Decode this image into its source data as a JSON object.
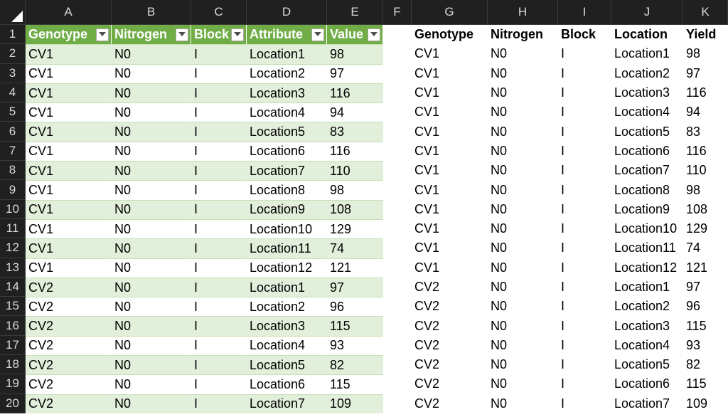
{
  "column_headers": [
    "A",
    "B",
    "C",
    "D",
    "E",
    "F",
    "G",
    "H",
    "I",
    "J",
    "K"
  ],
  "table": {
    "headers": [
      "Genotype",
      "Nitrogen",
      "Block",
      "Attribute",
      "Value"
    ],
    "rows": [
      [
        "CV1",
        "N0",
        "I",
        "Location1",
        "98"
      ],
      [
        "CV1",
        "N0",
        "I",
        "Location2",
        "97"
      ],
      [
        "CV1",
        "N0",
        "I",
        "Location3",
        "116"
      ],
      [
        "CV1",
        "N0",
        "I",
        "Location4",
        "94"
      ],
      [
        "CV1",
        "N0",
        "I",
        "Location5",
        "83"
      ],
      [
        "CV1",
        "N0",
        "I",
        "Location6",
        "116"
      ],
      [
        "CV1",
        "N0",
        "I",
        "Location7",
        "110"
      ],
      [
        "CV1",
        "N0",
        "I",
        "Location8",
        "98"
      ],
      [
        "CV1",
        "N0",
        "I",
        "Location9",
        "108"
      ],
      [
        "CV1",
        "N0",
        "I",
        "Location10",
        "129"
      ],
      [
        "CV1",
        "N0",
        "I",
        "Location11",
        "74"
      ],
      [
        "CV1",
        "N0",
        "I",
        "Location12",
        "121"
      ],
      [
        "CV2",
        "N0",
        "I",
        "Location1",
        "97"
      ],
      [
        "CV2",
        "N0",
        "I",
        "Location2",
        "96"
      ],
      [
        "CV2",
        "N0",
        "I",
        "Location3",
        "115"
      ],
      [
        "CV2",
        "N0",
        "I",
        "Location4",
        "93"
      ],
      [
        "CV2",
        "N0",
        "I",
        "Location5",
        "82"
      ],
      [
        "CV2",
        "N0",
        "I",
        "Location6",
        "115"
      ],
      [
        "CV2",
        "N0",
        "I",
        "Location7",
        "109"
      ]
    ]
  },
  "output": {
    "headers": [
      "Genotype",
      "Nitrogen",
      "Block",
      "Location",
      "Yield"
    ],
    "rows": [
      [
        "CV1",
        "N0",
        "I",
        "Location1",
        "98"
      ],
      [
        "CV1",
        "N0",
        "I",
        "Location2",
        "97"
      ],
      [
        "CV1",
        "N0",
        "I",
        "Location3",
        "116"
      ],
      [
        "CV1",
        "N0",
        "I",
        "Location4",
        "94"
      ],
      [
        "CV1",
        "N0",
        "I",
        "Location5",
        "83"
      ],
      [
        "CV1",
        "N0",
        "I",
        "Location6",
        "116"
      ],
      [
        "CV1",
        "N0",
        "I",
        "Location7",
        "110"
      ],
      [
        "CV1",
        "N0",
        "I",
        "Location8",
        "98"
      ],
      [
        "CV1",
        "N0",
        "I",
        "Location9",
        "108"
      ],
      [
        "CV1",
        "N0",
        "I",
        "Location10",
        "129"
      ],
      [
        "CV1",
        "N0",
        "I",
        "Location11",
        "74"
      ],
      [
        "CV1",
        "N0",
        "I",
        "Location12",
        "121"
      ],
      [
        "CV2",
        "N0",
        "I",
        "Location1",
        "97"
      ],
      [
        "CV2",
        "N0",
        "I",
        "Location2",
        "96"
      ],
      [
        "CV2",
        "N0",
        "I",
        "Location3",
        "115"
      ],
      [
        "CV2",
        "N0",
        "I",
        "Location4",
        "93"
      ],
      [
        "CV2",
        "N0",
        "I",
        "Location5",
        "82"
      ],
      [
        "CV2",
        "N0",
        "I",
        "Location6",
        "115"
      ],
      [
        "CV2",
        "N0",
        "I",
        "Location7",
        "109"
      ]
    ]
  },
  "colors": {
    "table_header": "#70ad47",
    "table_band": "#e2efda",
    "sheet_header_bg": "#202020",
    "sheet_header_text": "#d9d9d9"
  },
  "icons": {
    "filter_button": "filter-dropdown-icon",
    "select_all": "select-all-corner-icon"
  }
}
